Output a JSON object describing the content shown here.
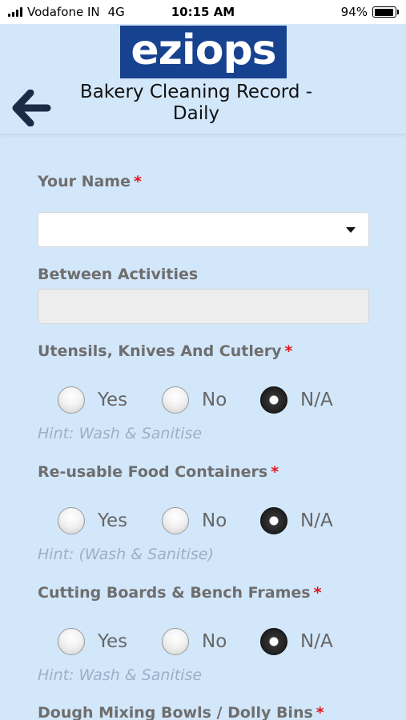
{
  "status": {
    "carrier": "Vodafone IN",
    "network": "4G",
    "time": "10:15 AM",
    "battery": "94%",
    "battery_level": 0.94
  },
  "header": {
    "logo_text": "eziops",
    "title": "Bakery Cleaning Record - Daily",
    "brand_color": "#17428f"
  },
  "form": {
    "your_name": {
      "label": "Your Name",
      "required_mark": "*",
      "value": ""
    },
    "between_activities": {
      "label": "Between Activities",
      "value": ""
    },
    "questions": [
      {
        "label": "Utensils, Knives And Cutlery",
        "required_mark": "*",
        "options": [
          "Yes",
          "No",
          "N/A"
        ],
        "selected": "N/A",
        "hint": "Hint: Wash & Sanitise"
      },
      {
        "label": "Re-usable Food Containers",
        "required_mark": "*",
        "options": [
          "Yes",
          "No",
          "N/A"
        ],
        "selected": "N/A",
        "hint": "Hint: (Wash & Sanitise)"
      },
      {
        "label": "Cutting Boards & Bench Frames",
        "required_mark": "*",
        "options": [
          "Yes",
          "No",
          "N/A"
        ],
        "selected": "N/A",
        "hint": "Hint: Wash & Sanitise"
      },
      {
        "label": "Dough Mixing Bowls / Dolly Bins",
        "required_mark": "*"
      }
    ]
  }
}
